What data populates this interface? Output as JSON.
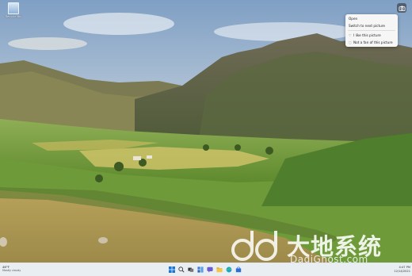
{
  "desktop": {
    "icons": [
      {
        "label": "Recycle Bin",
        "icon": "recycle-bin-icon"
      }
    ]
  },
  "spotlight": {
    "button_icon": "camera-icon",
    "menu": {
      "items": [
        {
          "label": "Open",
          "icon": ""
        },
        {
          "label": "Switch to next picture",
          "icon": ""
        },
        {
          "label": "I like this picture",
          "icon": "thumb-up-icon"
        },
        {
          "label": "Not a fan of this picture",
          "icon": "thumb-down-icon"
        }
      ]
    }
  },
  "watermark": {
    "cn_text": "大地系统",
    "sub_text": "DadiGhost.com"
  },
  "taskbar": {
    "weather_temp": "46°F",
    "weather_desc": "Mostly cloudy",
    "time": "4:47 PM",
    "date": "12/14/2021",
    "icons": [
      "windows-start-icon",
      "search-icon",
      "task-view-icon",
      "widgets-icon",
      "chat-icon",
      "file-explorer-icon",
      "edge-icon",
      "store-icon"
    ]
  },
  "colors": {
    "sky_top": "#9bb7d4",
    "grass": "#7fa23e",
    "taskbar": "#e9eef3"
  }
}
